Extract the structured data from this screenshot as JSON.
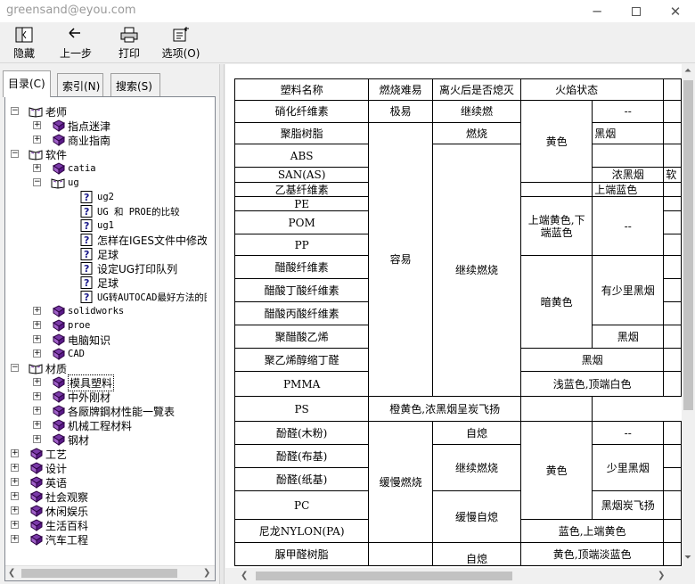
{
  "window": {
    "title": "greensand@eyou.com"
  },
  "toolbar": {
    "hide": "隐藏",
    "back": "上一步",
    "print": "打印",
    "options": "选项(O)"
  },
  "tabs": {
    "contents": "目录(C)",
    "index": "索引(N)",
    "search": "搜索(S)"
  },
  "tree": [
    {
      "label": "老师",
      "level": 0,
      "icon": "book-open-icon",
      "exp": "−"
    },
    {
      "label": "指点迷津",
      "level": 1,
      "icon": "book-closed-icon",
      "exp": "+"
    },
    {
      "label": "商业指南",
      "level": 1,
      "icon": "book-closed-icon",
      "exp": "+"
    },
    {
      "label": "软件",
      "level": 0,
      "icon": "book-open-icon",
      "exp": "−"
    },
    {
      "label": "catia",
      "level": 1,
      "icon": "book-closed-icon",
      "exp": "+",
      "mono": true
    },
    {
      "label": "ug",
      "level": 1,
      "icon": "book-open-icon",
      "exp": "−",
      "mono": true
    },
    {
      "label": "ug2",
      "level": 2,
      "icon": "help-page-icon",
      "mono": true
    },
    {
      "label": "UG 和 PROE的比较",
      "level": 2,
      "icon": "help-page-icon",
      "mono": true
    },
    {
      "label": "ug1",
      "level": 2,
      "icon": "help-page-icon",
      "mono": true
    },
    {
      "label": "怎样在IGES文件中修改公英制",
      "level": 2,
      "icon": "help-page-icon"
    },
    {
      "label": "足球",
      "level": 2,
      "icon": "help-page-icon"
    },
    {
      "label": "设定UG打印队列",
      "level": 2,
      "icon": "help-page-icon"
    },
    {
      "label": "足球",
      "level": 2,
      "icon": "help-page-icon"
    },
    {
      "label": "UG转AUTOCAD最好方法的图例",
      "level": 2,
      "icon": "help-page-icon",
      "mono": true
    },
    {
      "label": "solidworks",
      "level": 1,
      "icon": "book-closed-icon",
      "exp": "+",
      "mono": true
    },
    {
      "label": "proe",
      "level": 1,
      "icon": "book-closed-icon",
      "exp": "+",
      "mono": true
    },
    {
      "label": "电脑知识",
      "level": 1,
      "icon": "book-closed-icon",
      "exp": "+"
    },
    {
      "label": "CAD",
      "level": 1,
      "icon": "book-closed-icon",
      "exp": "+",
      "mono": true
    },
    {
      "label": "材质",
      "level": 0,
      "icon": "book-open-icon",
      "exp": "−"
    },
    {
      "label": "模具塑料",
      "level": 1,
      "icon": "book-closed-icon",
      "exp": "+",
      "selected": true
    },
    {
      "label": "中外刚材",
      "level": 1,
      "icon": "book-closed-icon",
      "exp": "+"
    },
    {
      "label": "各厰牌鋼材性能一覽表",
      "level": 1,
      "icon": "book-closed-icon",
      "exp": "+"
    },
    {
      "label": "机械工程材料",
      "level": 1,
      "icon": "book-closed-icon",
      "exp": "+"
    },
    {
      "label": "钢材",
      "level": 1,
      "icon": "book-closed-icon",
      "exp": "+"
    },
    {
      "label": "工艺",
      "level": 0,
      "icon": "book-closed-icon",
      "exp": "+"
    },
    {
      "label": "设计",
      "level": 0,
      "icon": "book-closed-icon",
      "exp": "+"
    },
    {
      "label": "英语",
      "level": 0,
      "icon": "book-closed-icon",
      "exp": "+"
    },
    {
      "label": "社会观察",
      "level": 0,
      "icon": "book-closed-icon",
      "exp": "+"
    },
    {
      "label": "休闲娱乐",
      "level": 0,
      "icon": "book-closed-icon",
      "exp": "+"
    },
    {
      "label": "生活百科",
      "level": 0,
      "icon": "book-closed-icon",
      "exp": "+"
    },
    {
      "label": "汽车工程",
      "level": 0,
      "icon": "book-closed-icon",
      "exp": "+"
    }
  ],
  "table": {
    "headers": [
      "塑料名称",
      "燃烧难易",
      "离火后是否熄灭",
      "火焰状态"
    ],
    "names": [
      "硝化纤维素",
      "聚脂树脂",
      "ABS",
      "SAN(AS)",
      "乙基纤维素",
      "PE",
      "POM",
      "PP",
      "醋酸纤维素",
      "醋酸丁酸纤维素",
      "醋酸丙酸纤维素",
      "聚醋酸乙烯",
      "聚乙烯醇缩丁醛",
      "PMMA",
      "PS",
      "酚醛(木粉)",
      "酚醛(布基)",
      "酚醛(纸基)",
      "PC",
      "尼龙NYLON(PA)",
      "脲甲醛树脂"
    ],
    "ease": [
      "极易",
      "容易",
      "缓慢燃烧"
    ],
    "extinguish": [
      "继续燃",
      "燃烧",
      "继续燃烧",
      "自熄",
      "继续燃烧",
      "缓慢自熄",
      "自熄"
    ],
    "flame": [
      "黄色",
      "上端黄色,下端蓝色",
      "暗黄色",
      "黑烟",
      "浅蓝色,顶端白色",
      "橙黄色,浓黑烟呈炭飞扬",
      "黄色",
      "蓝色,上端黄色",
      "黄色,顶端淡蓝色"
    ],
    "smoke": [
      "--",
      "黑烟",
      "浓黑烟",
      "上端蓝色",
      "--",
      "有少里黑烟",
      "黑烟",
      "--",
      "少里黑烟",
      "黑烟炭飞扬"
    ],
    "extra": "软"
  }
}
